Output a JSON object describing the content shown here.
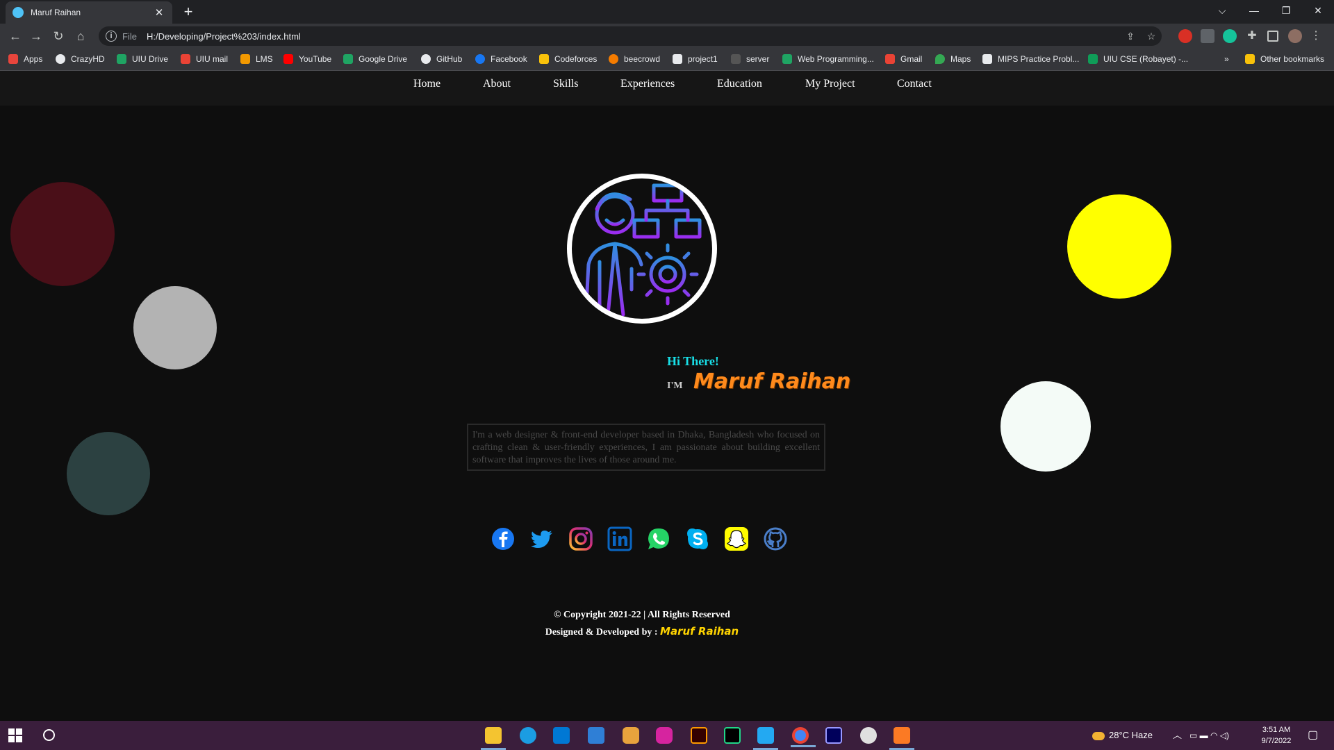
{
  "browser": {
    "tab_title": "Maruf Raihan",
    "new_tab": "+",
    "scheme_label": "File",
    "url": "H:/Developing/Project%203/index.html",
    "window_controls": [
      "⌵",
      "—",
      "❐",
      "✕"
    ]
  },
  "bookmarks": [
    {
      "label": "Apps",
      "color": "#e8453c"
    },
    {
      "label": "CrazyHD",
      "color": "#e8eaed"
    },
    {
      "label": "UIU Drive",
      "color": "#1fa463"
    },
    {
      "label": "UIU mail",
      "color": "#ea4335"
    },
    {
      "label": "LMS",
      "color": "#f29900"
    },
    {
      "label": "YouTube",
      "color": "#ff0000"
    },
    {
      "label": "Google Drive",
      "color": "#1fa463"
    },
    {
      "label": "GitHub",
      "color": "#e8eaed"
    },
    {
      "label": "Facebook",
      "color": "#1877f2"
    },
    {
      "label": "Codeforces",
      "color": "#f9c20a"
    },
    {
      "label": "beecrowd",
      "color": "#f57c00"
    },
    {
      "label": "project1",
      "color": "#e8eaed"
    },
    {
      "label": "server",
      "color": "#555555"
    },
    {
      "label": "Web Programming...",
      "color": "#1fa463"
    },
    {
      "label": "Gmail",
      "color": "#ea4335"
    },
    {
      "label": "Maps",
      "color": "#34a853"
    },
    {
      "label": "MIPS Practice Probl...",
      "color": "#e8eaed"
    },
    {
      "label": "UIU CSE (Robayet) -...",
      "color": "#0f9d58"
    }
  ],
  "bookmarks_overflow": "»",
  "other_bookmarks": "Other bookmarks",
  "site": {
    "nav": [
      "Home",
      "About",
      "Skills",
      "Experiences",
      "Education",
      "My Project",
      "Contact"
    ],
    "greeting": "Hi There!",
    "im_label": "I'M",
    "name": "Maruf Raihan",
    "bio": "I'm a web designer & front-end developer based in Dhaka, Bangladesh who focused on crafting clean & user-friendly experiences, I am passionate about building excellent software that improves the lives of those around me.",
    "socials": [
      "facebook-icon",
      "twitter-icon",
      "instagram-icon",
      "linkedin-icon",
      "whatsapp-icon",
      "skype-icon",
      "snapchat-icon",
      "github-icon"
    ],
    "copyright": "© Copyright 2021-22 | All Rights Reserved",
    "credit_prefix": "Designed & Developed by :",
    "credit_name": "Maruf Raihan"
  },
  "colors": {
    "bubble_maroon": "#4a0f18",
    "bubble_gray": "#b3b3b3",
    "bubble_teal": "#2c4141",
    "bubble_yellow": "#ffff00",
    "bubble_white": "#f4fbf7",
    "accent_cyan": "#18e0e8",
    "accent_orange": "#ff8a1c"
  },
  "taskbar": {
    "weather": "28°C  Haze",
    "time": "3:51 AM",
    "date": "9/7/2022"
  }
}
